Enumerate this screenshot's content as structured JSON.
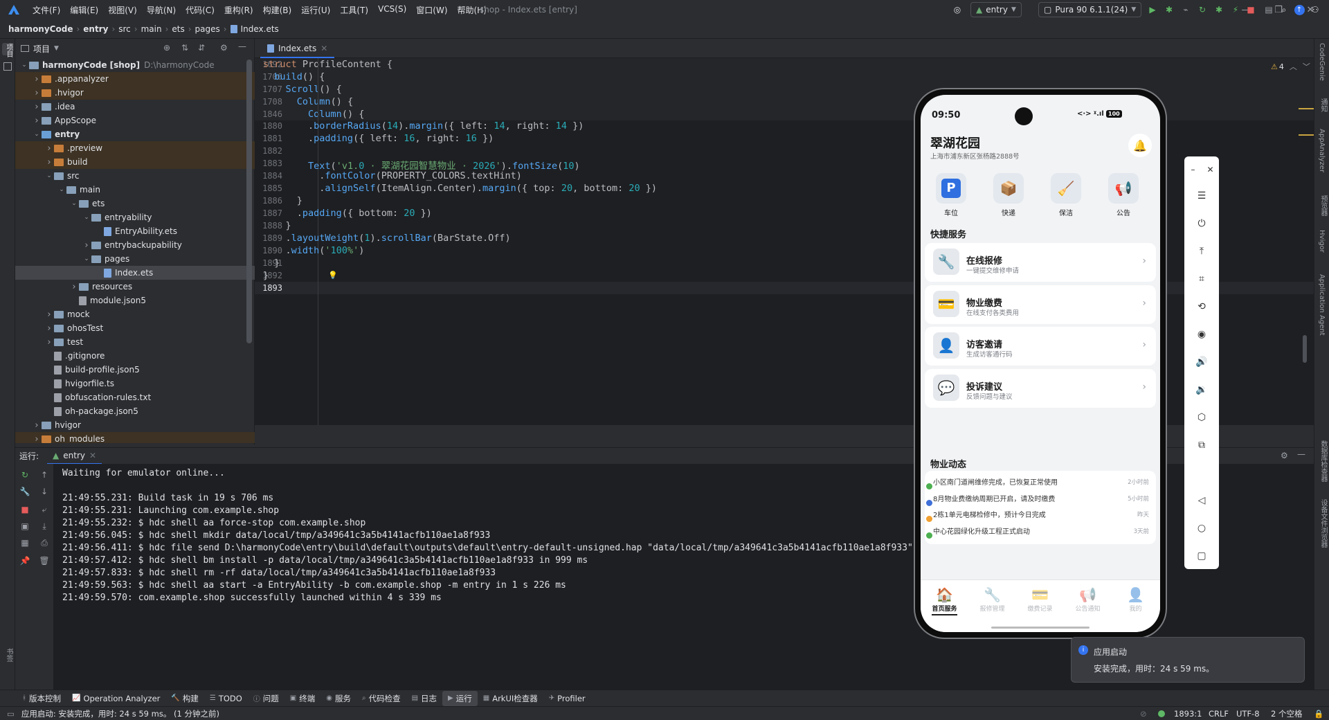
{
  "menu": [
    "文件(F)",
    "编辑(E)",
    "视图(V)",
    "导航(N)",
    "代码(C)",
    "重构(R)",
    "构建(B)",
    "运行(U)",
    "工具(T)",
    "VCS(S)",
    "窗口(W)",
    "帮助(H)"
  ],
  "window_title": "shop - Index.ets [entry]",
  "breadcrumb": [
    "harmonyCode",
    "entry",
    "src",
    "main",
    "ets",
    "pages",
    "Index.ets"
  ],
  "toolbar": {
    "run_config": "entry",
    "device": "Pura 90 6.1.1(24)",
    "warnings": "4"
  },
  "left_stripe": {
    "project": "项目",
    "bookmarks": "书签",
    "structure": "结构"
  },
  "right_stripe": [
    "CodeGenie",
    "通知",
    "AppAnalyzer",
    "预览器",
    "Hvigor",
    "Application Agent",
    "数据库检查器",
    "设备文件浏览器"
  ],
  "project_panel": {
    "title": "项目",
    "tree": [
      {
        "label": "harmonyCode [shop]",
        "extra": "D:\\harmonyCode",
        "depth": 0,
        "type": "folder",
        "open": true
      },
      {
        "label": ".appanalyzer",
        "depth": 1,
        "type": "folder-orange",
        "open": false
      },
      {
        "label": ".hvigor",
        "depth": 1,
        "type": "folder-orange",
        "open": false
      },
      {
        "label": ".idea",
        "depth": 1,
        "type": "folder",
        "open": false
      },
      {
        "label": "AppScope",
        "depth": 1,
        "type": "folder",
        "open": false
      },
      {
        "label": "entry",
        "depth": 1,
        "type": "folder-blue",
        "open": true
      },
      {
        "label": ".preview",
        "depth": 2,
        "type": "folder-orange",
        "open": false
      },
      {
        "label": "build",
        "depth": 2,
        "type": "folder-orange",
        "open": false
      },
      {
        "label": "src",
        "depth": 2,
        "type": "folder",
        "open": true
      },
      {
        "label": "main",
        "depth": 3,
        "type": "folder",
        "open": true
      },
      {
        "label": "ets",
        "depth": 4,
        "type": "folder",
        "open": true
      },
      {
        "label": "entryability",
        "depth": 5,
        "type": "folder",
        "open": true
      },
      {
        "label": "EntryAbility.ets",
        "depth": 6,
        "type": "ets"
      },
      {
        "label": "entrybackupability",
        "depth": 5,
        "type": "folder",
        "open": false
      },
      {
        "label": "pages",
        "depth": 5,
        "type": "folder",
        "open": true
      },
      {
        "label": "Index.ets",
        "depth": 6,
        "type": "ets"
      },
      {
        "label": "resources",
        "depth": 4,
        "type": "folder",
        "open": false
      },
      {
        "label": "module.json5",
        "depth": 4,
        "type": "file"
      },
      {
        "label": "mock",
        "depth": 2,
        "type": "folder",
        "open": false
      },
      {
        "label": "ohosTest",
        "depth": 2,
        "type": "folder",
        "open": false
      },
      {
        "label": "test",
        "depth": 2,
        "type": "folder",
        "open": false
      },
      {
        "label": ".gitignore",
        "depth": 2,
        "type": "file"
      },
      {
        "label": "build-profile.json5",
        "depth": 2,
        "type": "file"
      },
      {
        "label": "hvigorfile.ts",
        "depth": 2,
        "type": "file"
      },
      {
        "label": "obfuscation-rules.txt",
        "depth": 2,
        "type": "file"
      },
      {
        "label": "oh-package.json5",
        "depth": 2,
        "type": "file"
      },
      {
        "label": "hvigor",
        "depth": 1,
        "type": "folder",
        "open": false
      },
      {
        "label": "oh_modules",
        "depth": 1,
        "type": "folder-orange",
        "open": false
      }
    ]
  },
  "editor": {
    "tab": "Index.ets",
    "sticky": [
      {
        "num": "1692",
        "code": "struct ProfileContent {"
      },
      {
        "num": "1706",
        "code": "  build() {"
      },
      {
        "num": "1707",
        "code": "    Scroll() {"
      },
      {
        "num": "1708",
        "code": "      Column() {"
      },
      {
        "num": "1846",
        "code": "        Column() {"
      }
    ],
    "lines": [
      {
        "num": "1880",
        "code": "        .borderRadius(14).margin({ left: 14, right: 14 })"
      },
      {
        "num": "1881",
        "code": "        .padding({ left: 16, right: 16 })"
      },
      {
        "num": "1882",
        "code": ""
      },
      {
        "num": "1883",
        "code": "        Text('v1.0 · 翠湖花园智慧物业 · 2026').fontSize(10)"
      },
      {
        "num": "1884",
        "code": "          .fontColor(PROPERTY_COLORS.textHint)"
      },
      {
        "num": "1885",
        "code": "          .alignSelf(ItemAlign.Center).margin({ top: 20, bottom: 20 })"
      },
      {
        "num": "1886",
        "code": "      }"
      },
      {
        "num": "1887",
        "code": "      .padding({ bottom: 20 })"
      },
      {
        "num": "1888",
        "code": "    }"
      },
      {
        "num": "1889",
        "code": "    .layoutWeight(1).scrollBar(BarState.Off)"
      },
      {
        "num": "1890",
        "code": "    .width('100%')"
      },
      {
        "num": "1891",
        "code": "  }"
      },
      {
        "num": "1892",
        "code": "}"
      },
      {
        "num": "1893",
        "code": ""
      }
    ]
  },
  "run_panel": {
    "label": "运行:",
    "tab": "entry",
    "lines": [
      "Waiting for emulator online...",
      "",
      "21:49:55.231: Build task in 19 s 706 ms",
      "21:49:55.231: Launching com.example.shop",
      "21:49:55.232: $ hdc shell aa force-stop com.example.shop",
      "21:49:56.045: $ hdc shell mkdir data/local/tmp/a349641c3a5b4141acfb110ae1a8f933",
      "21:49:56.411: $ hdc file send D:\\harmonyCode\\entry\\build\\default\\outputs\\default\\entry-default-unsigned.hap \"data/local/tmp/a349641c3a5b4141acfb110ae1a8f933\"",
      "21:49:57.412: $ hdc shell bm install -p data/local/tmp/a349641c3a5b4141acfb110ae1a8f933 in 999 ms",
      "21:49:57.833: $ hdc shell rm -rf data/local/tmp/a349641c3a5b4141acfb110ae1a8f933",
      "21:49:59.563: $ hdc shell aa start -a EntryAbility -b com.example.shop -m entry in 1 s 226 ms",
      "21:49:59.570: com.example.shop successfully launched within 4 s 339 ms"
    ]
  },
  "bottom_tools": [
    "版本控制",
    "Operation Analyzer",
    "构建",
    "TODO",
    "问题",
    "终端",
    "服务",
    "代码检查",
    "日志",
    "运行",
    "ArkUI检查器",
    "Profiler"
  ],
  "status": {
    "message": "应用启动: 安装完成，用时: 24 s 59 ms。 (1 分钟之前)",
    "position": "1893:1",
    "line_sep": "CRLF",
    "encoding": "UTF-8",
    "indent": "2 个空格"
  },
  "notification": {
    "title": "应用启动",
    "body": "安装完成，用时：24 s 59 ms。"
  },
  "phone": {
    "time": "09:50",
    "battery": "100",
    "title": "翠湖花园",
    "address": "上海市浦东新区张杨路2888号",
    "quick": [
      {
        "icon": "parking-icon",
        "glyph": "P",
        "label": "车位"
      },
      {
        "icon": "package-icon",
        "glyph": "📦",
        "label": "快递"
      },
      {
        "icon": "broom-icon",
        "glyph": "🧹",
        "label": "保洁"
      },
      {
        "icon": "megaphone-icon",
        "glyph": "📢",
        "label": "公告"
      }
    ],
    "services_title": "快捷服务",
    "services": [
      {
        "icon": "wrench-icon",
        "glyph": "🔧",
        "title": "在线报修",
        "sub": "一键提交维修申请"
      },
      {
        "icon": "card-icon",
        "glyph": "💳",
        "title": "物业缴费",
        "sub": "在线支付各类费用"
      },
      {
        "icon": "visitor-icon",
        "glyph": "👤",
        "title": "访客邀请",
        "sub": "生成访客通行码"
      },
      {
        "icon": "chat-icon",
        "glyph": "💬",
        "title": "投诉建议",
        "sub": "反馈问题与建议"
      }
    ],
    "news_title": "物业动态",
    "news": [
      {
        "color": "#4caf50",
        "text": "小区南门道闸维修完成，已恢复正常使用",
        "time": "2小时前"
      },
      {
        "color": "#3f6fd8",
        "text": "8月物业费缴纳周期已开启，请及时缴费",
        "time": "5小时前"
      },
      {
        "color": "#f0a030",
        "text": "2栋1单元电梯检修中，预计今日完成",
        "time": "昨天"
      },
      {
        "color": "#4caf50",
        "text": "中心花园绿化升级工程正式启动",
        "time": "3天前"
      }
    ],
    "tabs": [
      {
        "icon": "home-icon",
        "glyph": "🏠",
        "label": "首页服务",
        "active": true
      },
      {
        "icon": "repair-icon",
        "glyph": "🔧",
        "label": "报修管理",
        "active": false
      },
      {
        "icon": "bill-icon",
        "glyph": "💳",
        "label": "缴费记录",
        "active": false
      },
      {
        "icon": "notice-icon",
        "glyph": "📢",
        "label": "公告通知",
        "active": false
      },
      {
        "icon": "profile-icon",
        "glyph": "👤",
        "label": "我的",
        "active": false
      }
    ]
  }
}
